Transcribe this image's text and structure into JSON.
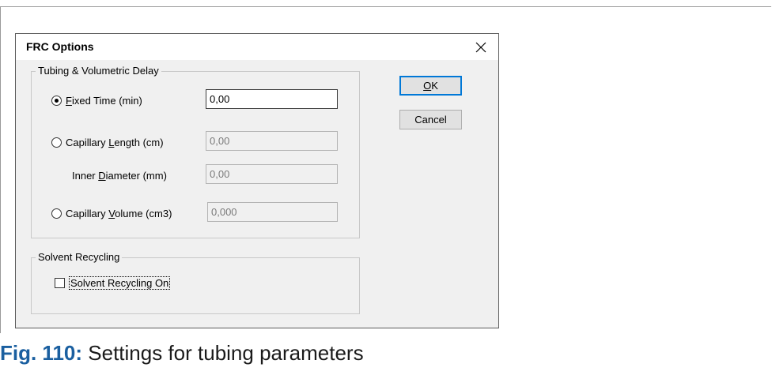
{
  "dialog": {
    "title": "FRC Options",
    "close_icon": "close-icon"
  },
  "tubing_group": {
    "label": "Tubing & Volumetric Delay",
    "fixed_time": {
      "label_pre": "",
      "label_key": "F",
      "label_post": "ixed Time (min)",
      "value": "0,00",
      "selected": true
    },
    "capillary_length": {
      "label_pre": "Capillary ",
      "label_key": "L",
      "label_post": "ength (cm)",
      "value": "0,00",
      "selected": false
    },
    "inner_diameter": {
      "label_pre": "Inner ",
      "label_key": "D",
      "label_post": "iameter (mm)",
      "value": "0,00"
    },
    "capillary_volume": {
      "label_pre": "Capillary ",
      "label_key": "V",
      "label_post": "olume (cm3)",
      "value": "0,000",
      "selected": false
    }
  },
  "buttons": {
    "ok": {
      "label_key": "O",
      "label_post": "K"
    },
    "cancel": "Cancel"
  },
  "recycling_group": {
    "label": "Solvent Recycling",
    "checkbox_label": "Solvent Recycling On",
    "checked": false
  },
  "caption": {
    "number": "Fig. 110:",
    "text": "Settings for tubing parameters"
  }
}
